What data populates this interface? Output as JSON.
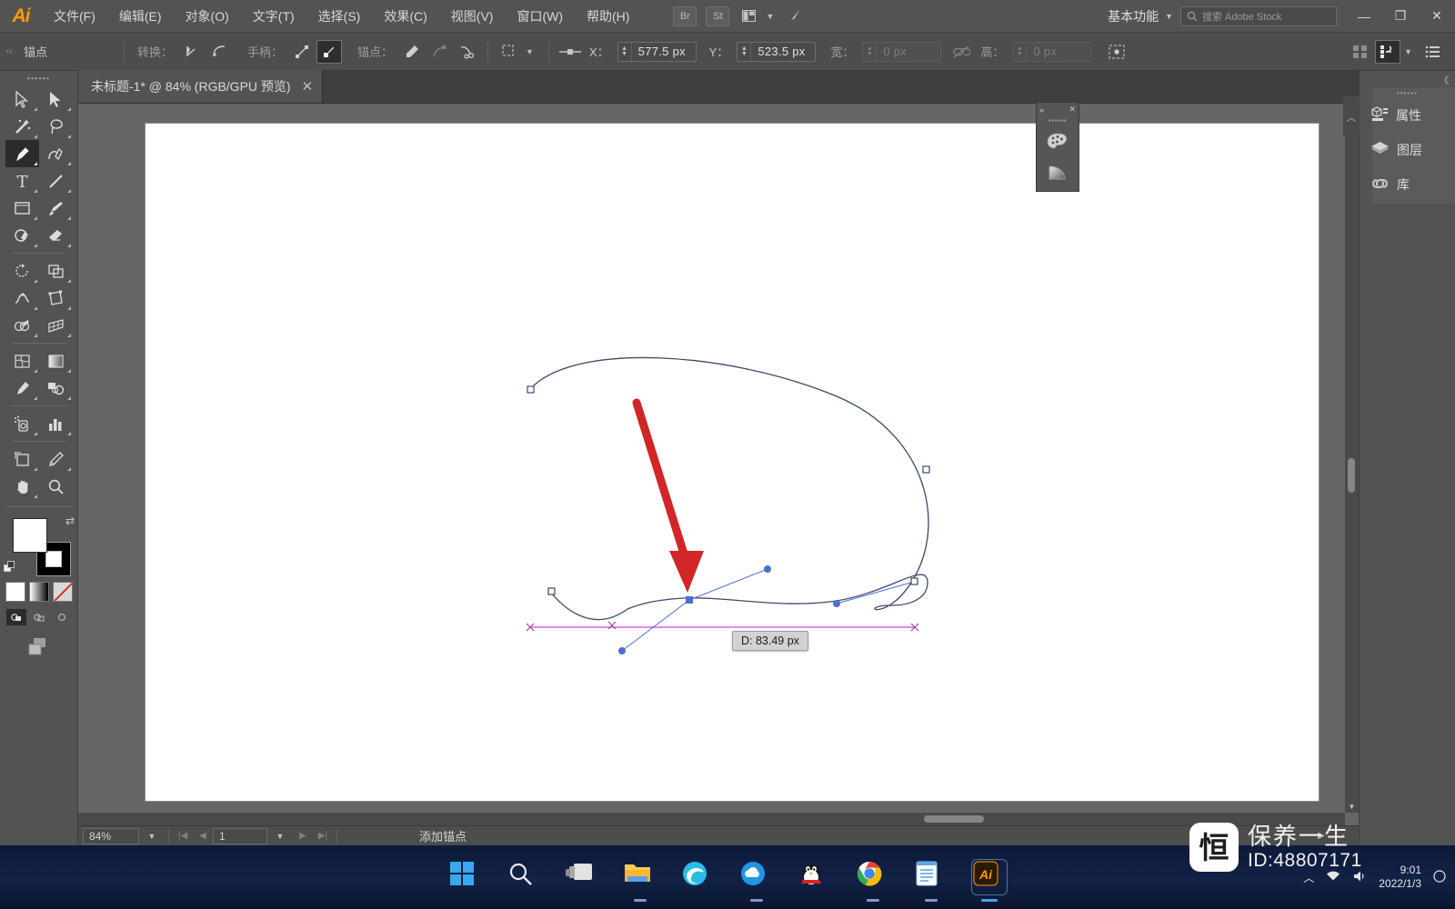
{
  "app": {
    "logo": "Ai",
    "menus": [
      {
        "label": "文件(F)"
      },
      {
        "label": "编辑(E)"
      },
      {
        "label": "对象(O)"
      },
      {
        "label": "文字(T)"
      },
      {
        "label": "选择(S)"
      },
      {
        "label": "效果(C)"
      },
      {
        "label": "视图(V)"
      },
      {
        "label": "窗口(W)"
      },
      {
        "label": "帮助(H)"
      }
    ],
    "bridge_label": "Br",
    "stock_label": "St",
    "workspace": "基本功能",
    "stock_search_placeholder": "搜索 Adobe Stock",
    "window_buttons": {
      "minimize": "—",
      "restore": "❐",
      "close": "✕"
    }
  },
  "control_bar": {
    "context_label": "锚点",
    "convert_label": "转换：",
    "handles_label": "手柄：",
    "anchors_label": "锚点：",
    "x_label": "X：",
    "x_value": "577.5 px",
    "y_label": "Y：",
    "y_value": "523.5 px",
    "w_label": "宽：",
    "w_value": "0 px",
    "h_label": "高：",
    "h_value": "0 px"
  },
  "document": {
    "tab_title": "未标题-1* @ 84% (RGB/GPU 预览)",
    "close_glyph": "✕"
  },
  "tools": [
    {
      "name": "selection-tool",
      "label": "选择工具"
    },
    {
      "name": "direct-selection-tool",
      "label": "直接选择工具"
    },
    {
      "name": "magic-wand-tool",
      "label": "魔棒工具"
    },
    {
      "name": "lasso-tool",
      "label": "套索工具"
    },
    {
      "name": "pen-tool",
      "label": "钢笔工具",
      "active": true
    },
    {
      "name": "curvature-tool",
      "label": "曲率工具"
    },
    {
      "name": "type-tool",
      "label": "文字工具"
    },
    {
      "name": "line-segment-tool",
      "label": "直线段工具"
    },
    {
      "name": "rectangle-tool",
      "label": "矩形工具"
    },
    {
      "name": "paintbrush-tool",
      "label": "画笔工具"
    },
    {
      "name": "shaper-tool",
      "label": "Shaper 工具"
    },
    {
      "name": "eraser-tool",
      "label": "橡皮擦工具"
    },
    {
      "name": "rotate-tool",
      "label": "旋转工具"
    },
    {
      "name": "scale-tool",
      "label": "比例缩放工具"
    },
    {
      "name": "width-tool",
      "label": "宽度工具"
    },
    {
      "name": "free-transform-tool",
      "label": "自由变换工具"
    },
    {
      "name": "shape-builder-tool",
      "label": "形状生成器工具"
    },
    {
      "name": "perspective-grid-tool",
      "label": "透视网格工具"
    },
    {
      "name": "mesh-tool",
      "label": "网格工具"
    },
    {
      "name": "gradient-tool",
      "label": "渐变工具"
    },
    {
      "name": "eyedropper-tool",
      "label": "吸管工具"
    },
    {
      "name": "blend-tool",
      "label": "混合工具"
    },
    {
      "name": "symbol-sprayer-tool",
      "label": "符号喷枪工具"
    },
    {
      "name": "column-graph-tool",
      "label": "柱形图工具"
    },
    {
      "name": "artboard-tool",
      "label": "画板工具"
    },
    {
      "name": "slice-tool",
      "label": "切片工具"
    },
    {
      "name": "hand-tool",
      "label": "抓手工具"
    },
    {
      "name": "zoom-tool",
      "label": "缩放工具"
    }
  ],
  "color_controls": {
    "fill_color": "#ffffff",
    "stroke_color": "#000000",
    "swap_glyph": "⇄",
    "modes": [
      "颜色",
      "渐变",
      "无"
    ]
  },
  "canvas": {
    "tooltip": "D: 83.49 px",
    "guide_color": "#e060e0",
    "path_color": "#3c4a6b",
    "anchor_fill": "#ffffff",
    "handle_color": "#4a6fd4",
    "arrow_color": "#d01a1a"
  },
  "mini_panel": {
    "collapse_glyph": "»",
    "close_glyph": "✕",
    "buttons": [
      {
        "name": "color-panel-icon",
        "label": "颜色"
      },
      {
        "name": "gradient-panel-icon",
        "label": "渐变"
      }
    ]
  },
  "right_dock": {
    "collapse_glyph": "《",
    "items": [
      {
        "label": "属性",
        "icon": "properties-icon"
      },
      {
        "label": "图层",
        "icon": "layers-icon"
      },
      {
        "label": "库",
        "icon": "libraries-icon"
      }
    ]
  },
  "status_bar": {
    "zoom": "84%",
    "page": "1",
    "status_text": "添加锚点",
    "first_glyph": "|◀",
    "prev_glyph": "◀",
    "next_glyph": "▶",
    "last_glyph": "▶|",
    "play_glyph": "▶",
    "collapse_glyph": "‹"
  },
  "taskbar": {
    "apps": [
      {
        "name": "start-button",
        "label": "开始"
      },
      {
        "name": "search-button",
        "label": "搜索"
      },
      {
        "name": "task-view-button",
        "label": "任务视图"
      },
      {
        "name": "file-explorer-button",
        "label": "文件资源管理器"
      },
      {
        "name": "edge-button",
        "label": "Microsoft Edge"
      },
      {
        "name": "cloud-app-button",
        "label": "云应用"
      },
      {
        "name": "qq-button",
        "label": "QQ"
      },
      {
        "name": "chrome-button",
        "label": "Google Chrome"
      },
      {
        "name": "notepad-button",
        "label": "记事本"
      },
      {
        "name": "illustrator-button",
        "label": "Adobe Illustrator"
      }
    ],
    "tray": {
      "overflow_glyph": "︿",
      "time": "9:01",
      "date": "2022/1/3"
    }
  },
  "watermark": {
    "logo_char": "恒",
    "title": "保养一生",
    "id": "ID:48807171"
  }
}
